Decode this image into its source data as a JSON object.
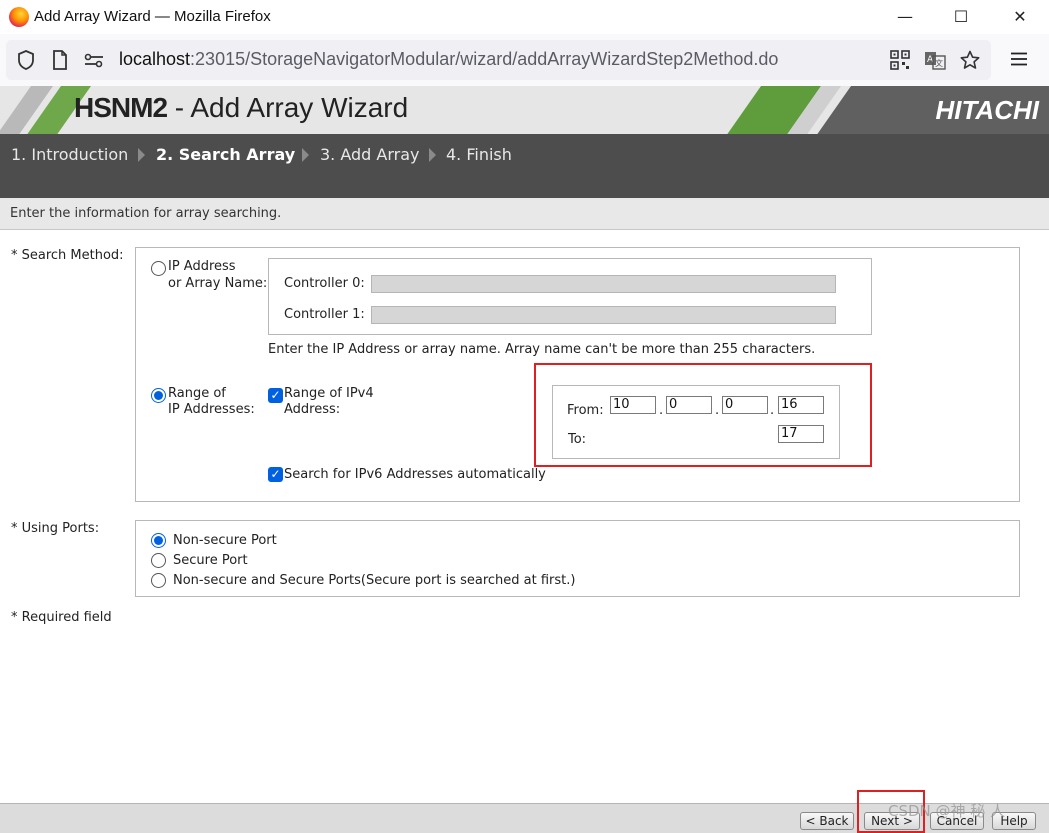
{
  "window": {
    "title": "Add Array Wizard — Mozilla Firefox",
    "minimize": "—",
    "maximize": "☐",
    "close": "✕"
  },
  "urlbar": {
    "host": "localhost",
    "rest": ":23015/StorageNavigatorModular/wizard/addArrayWizardStep2Method.do"
  },
  "banner": {
    "app_name": "HSNM2",
    "subtitle": " - Add Array Wizard",
    "brand": "HITACHI"
  },
  "steps": [
    {
      "label": "1. Introduction"
    },
    {
      "label": "2. Search Array"
    },
    {
      "label": "3. Add Array"
    },
    {
      "label": "4. Finish"
    }
  ],
  "info": "Enter the information for array searching.",
  "search_method": {
    "label": "* Search Method:",
    "option_ip_line1": "IP Address",
    "option_ip_line2": "or Array Name:",
    "controller0_label": "Controller 0:",
    "controller1_label": "Controller 1:",
    "controller0_value": "",
    "controller1_value": "",
    "hint": "Enter the IP Address or array name. Array name can't be more than 255 characters.",
    "option_range_line1": "Range of",
    "option_range_line2": "IP Addresses:",
    "ipv4_check_line1": "Range of IPv4",
    "ipv4_check_line2": "Address:",
    "from_label": "From:",
    "to_label": "To:",
    "from_octets": [
      "10",
      "0",
      "0",
      "16"
    ],
    "to_value": "17",
    "ipv6_label": "Search for IPv6 Addresses automatically"
  },
  "ports": {
    "label": "* Using Ports:",
    "options": [
      "Non-secure Port",
      "Secure Port",
      "Non-secure and Secure Ports(Secure port is searched at first.)"
    ]
  },
  "required_note": "* Required field",
  "footer": {
    "back": "< Back",
    "next": "Next >",
    "cancel": "Cancel",
    "help": "Help"
  },
  "watermark": "CSDN @神 秘 人",
  "colors": {
    "accent": "#0061e0",
    "highlight": "#e02020",
    "steps_bg": "#4d4d4d"
  }
}
